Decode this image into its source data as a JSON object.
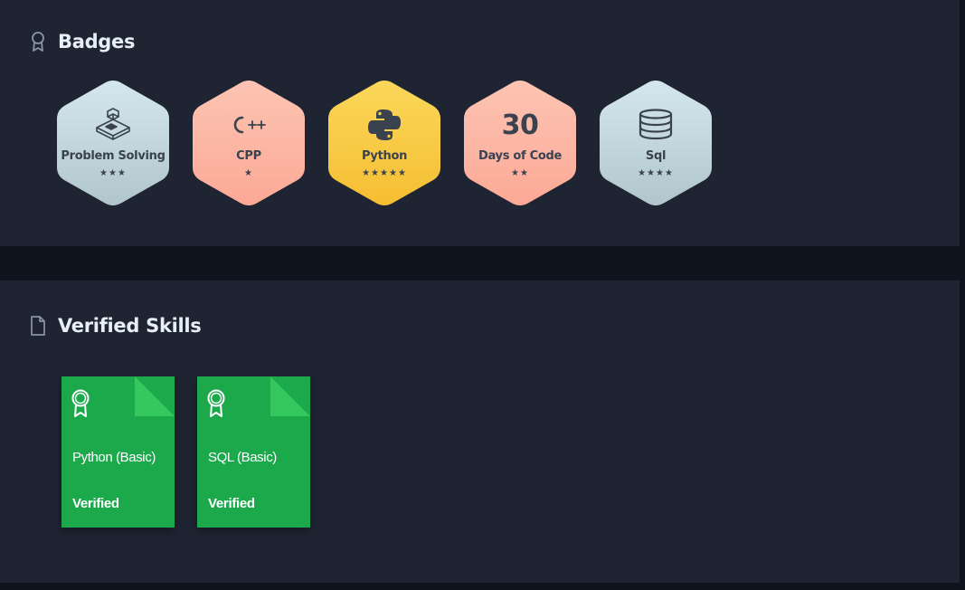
{
  "badges": {
    "title": "Badges",
    "icon": "ribbon-icon",
    "items": [
      {
        "label": "Problem Solving",
        "stars": "★★★",
        "star_count": 3,
        "icon": "isometric-blocks-icon",
        "color_top": "#d5e7ee",
        "color_bottom": "#b0c6cc"
      },
      {
        "label": "CPP",
        "stars": "★",
        "star_count": 1,
        "icon": "cpp-icon",
        "icon_text": "C++",
        "color_top": "#fdc4b3",
        "color_bottom": "#fca996"
      },
      {
        "label": "Python",
        "stars": "★★★★★",
        "star_count": 5,
        "icon": "python-logo-icon",
        "color_top": "#fbd75a",
        "color_bottom": "#f5be32"
      },
      {
        "label": "Days of Code",
        "stars": "★★",
        "star_count": 2,
        "icon": "number-icon",
        "icon_text": "30",
        "color_top": "#fdc4b3",
        "color_bottom": "#fca996"
      },
      {
        "label": "Sql",
        "stars": "★★★★",
        "star_count": 4,
        "icon": "database-icon",
        "color_top": "#d5e7ee",
        "color_bottom": "#b0c6cc"
      }
    ]
  },
  "skills": {
    "title": "Verified Skills",
    "icon": "document-icon",
    "items": [
      {
        "name": "Python (Basic)",
        "status": "Verified"
      },
      {
        "name": "SQL (Basic)",
        "status": "Verified"
      }
    ]
  },
  "colors": {
    "background": "#0e141e",
    "panel": "#1f2433",
    "certificate_green": "#1ba94c",
    "certificate_fold": "#34c85e",
    "badge_text": "#39424e"
  }
}
